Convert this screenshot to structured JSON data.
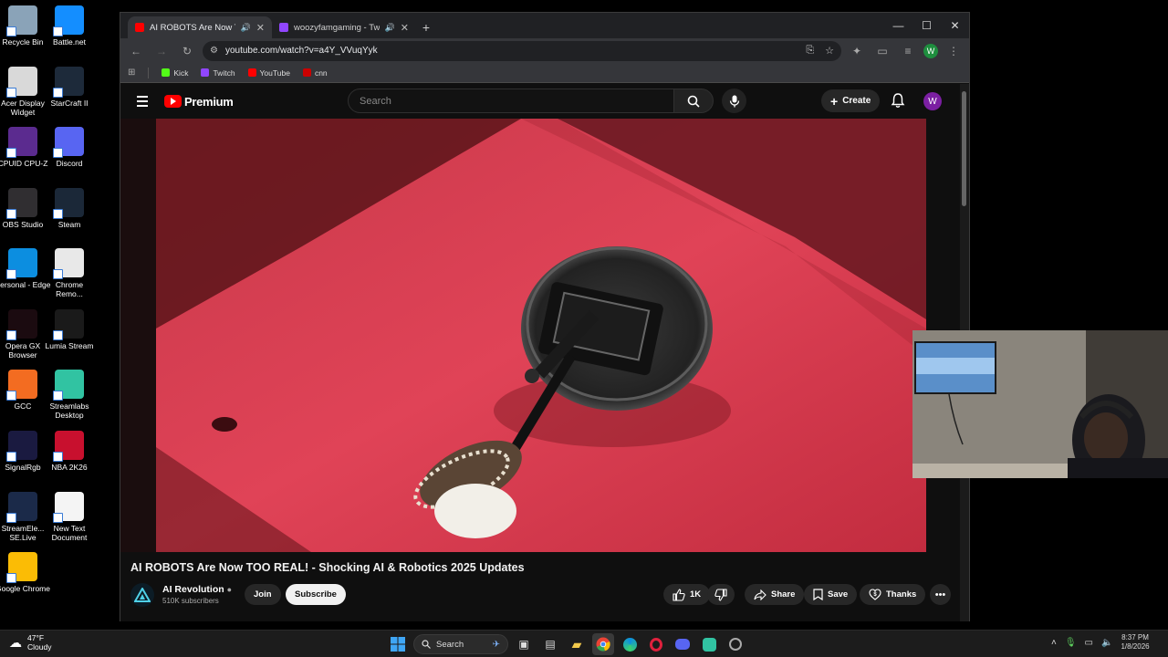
{
  "desktop": {
    "icons": [
      {
        "label": "Recycle Bin",
        "color": "#8aa3b8"
      },
      {
        "label": "Battle.net",
        "color": "#148eff"
      },
      {
        "label": "Acer Display Widget",
        "color": "#d9d9d9"
      },
      {
        "label": "StarCraft II",
        "color": "#1d2a3a"
      },
      {
        "label": "CPUID CPU-Z",
        "color": "#5b2b8f"
      },
      {
        "label": "Discord",
        "color": "#5865f2"
      },
      {
        "label": "OBS Studio",
        "color": "#302e31"
      },
      {
        "label": "Steam",
        "color": "#1b2838"
      },
      {
        "label": "Personal - Edge",
        "color": "#0c8ee0"
      },
      {
        "label": "Chrome Remo...",
        "color": "#e8e8e8"
      },
      {
        "label": "Opera GX Browser",
        "color": "#1b0b10"
      },
      {
        "label": "Lumia Stream",
        "color": "#1a1a1a"
      },
      {
        "label": "GCC",
        "color": "#f36c21"
      },
      {
        "label": "Streamlabs Desktop",
        "color": "#31c3a2"
      },
      {
        "label": "SignalRgb",
        "color": "#1a1a40"
      },
      {
        "label": "NBA 2K26",
        "color": "#c8102e"
      },
      {
        "label": "StreamEle... SE.Live",
        "color": "#1b2a49"
      },
      {
        "label": "New Text Document",
        "color": "#f4f4f4"
      },
      {
        "label": "Google Chrome",
        "color": "#fbbc05"
      }
    ]
  },
  "browser": {
    "tabs": [
      {
        "title": "AI ROBOTS Are Now TOO REAL",
        "active": true,
        "fav_color": "#ff0000"
      },
      {
        "title": "woozyfamgaming - Twitch",
        "active": false,
        "fav_color": "#9146ff"
      }
    ],
    "new_tab": "+",
    "controls": {
      "minimize": "—",
      "maximize": "☐",
      "close": "✕"
    },
    "url": "youtube.com/watch?v=a4Y_VVuqYyk",
    "profile_initial": "W",
    "bookmarks": [
      {
        "label": "Kick",
        "color": "#53fc18"
      },
      {
        "label": "Twitch",
        "color": "#9146ff"
      },
      {
        "label": "YouTube",
        "color": "#ff0000"
      },
      {
        "label": "cnn",
        "color": "#cc0000"
      }
    ]
  },
  "youtube": {
    "brand": "Premium",
    "search_placeholder": "Search",
    "create_label": "Create",
    "avatar_initial": "W",
    "video_title": "AI ROBOTS Are Now TOO REAL! - Shocking AI & Robotics 2025 Updates",
    "channel": {
      "name": "AI Revolution",
      "subscribers": "510K subscribers"
    },
    "join_label": "Join",
    "subscribe_label": "Subscribe",
    "like_count": "1K",
    "share_label": "Share",
    "save_label": "Save",
    "thanks_label": "Thanks",
    "more_label": "•••"
  },
  "taskbar": {
    "temperature": "47°F",
    "condition": "Cloudy",
    "search_label": "Search",
    "time": "8:37 PM",
    "date": "1/8/2026"
  }
}
